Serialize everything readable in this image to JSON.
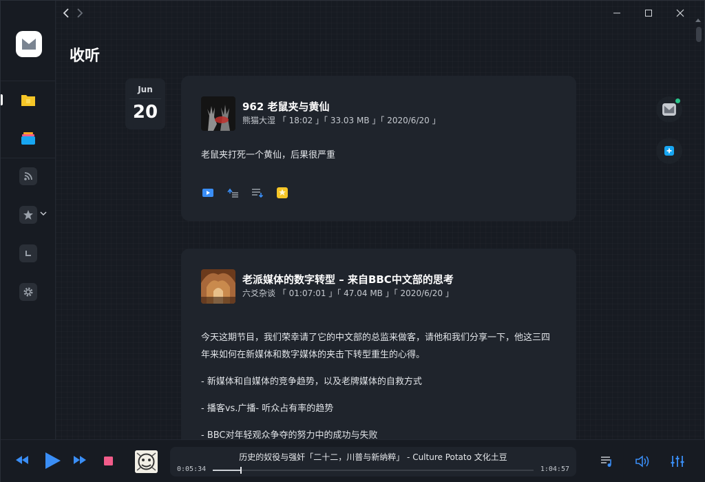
{
  "page": {
    "title": "收听"
  },
  "date": {
    "month": "Jun",
    "day": "20"
  },
  "episodes": [
    {
      "title": "962 老鼠夹与黄仙",
      "meta": "熊猫大湿 「 18:02 」「 33.03 MB 」「 2020/6/20 」",
      "description": [
        "老鼠夹打死一个黄仙，后果很严重"
      ]
    },
    {
      "title": "老派媒体的数字转型 – 来自BBC中文部的思考",
      "meta": "六爻杂谈 「 01:07:01 」「 47.04 MB 」「 2020/6/20 」",
      "description": [
        "今天这期节目，我们荣幸请了它的中文部的总监来做客，请他和我们分享一下，他这三四年来如何在新媒体和数字媒体的夹击下转型重生的心得。",
        "- 新媒体和自媒体的竞争趋势，以及老牌媒体的自救方式",
        "- 播客vs.广播- 听众占有率的趋势",
        "- BBC对年轻观众争夺的努力中的成功与失败"
      ]
    }
  ],
  "player": {
    "now_playing": "历史的奴役与强奸「二十二，川普与新纳粹」 - Culture Potato 文化土豆",
    "elapsed": "0:05:34",
    "duration": "1:04:57",
    "progress": 0.086
  },
  "colors": {
    "accent_blue": "#3a8ef6",
    "stop_pink": "#f25c8a",
    "folder_yellow": "#f6c627",
    "online_green": "#28c38a"
  },
  "icons": {
    "nav": [
      "folder-icon",
      "stack-icon",
      "rss-icon",
      "star-icon",
      "history-icon",
      "settings-icon"
    ],
    "actions": [
      "play-icon",
      "play-next-icon",
      "add-to-queue-icon",
      "favorite-icon"
    ]
  }
}
